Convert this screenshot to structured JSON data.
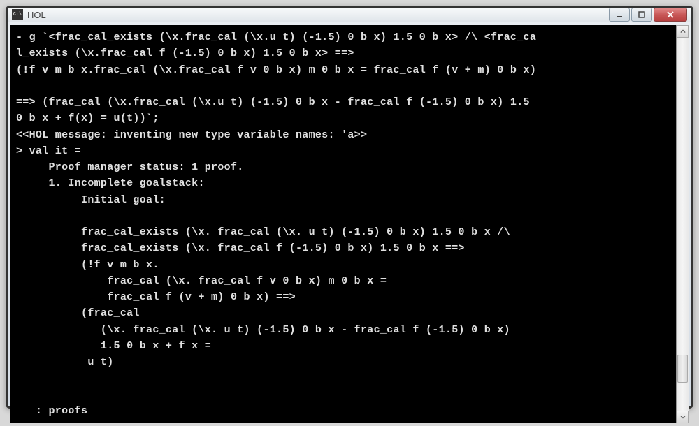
{
  "window": {
    "icon_text": "C:\\",
    "title": "HOL"
  },
  "terminal": {
    "lines": [
      "- g `<frac_cal_exists (\\x.frac_cal (\\x.u t) (-1.5) 0 b x) 1.5 0 b x> /\\ <frac_ca",
      "l_exists (\\x.frac_cal f (-1.5) 0 b x) 1.5 0 b x> ==>",
      "(!f v m b x.frac_cal (\\x.frac_cal f v 0 b x) m 0 b x = frac_cal f (v + m) 0 b x)",
      "",
      "==> (frac_cal (\\x.frac_cal (\\x.u t) (-1.5) 0 b x - frac_cal f (-1.5) 0 b x) 1.5",
      "0 b x + f(x) = u(t))`;",
      "<<HOL message: inventing new type variable names: 'a>>",
      "> val it =",
      "     Proof manager status: 1 proof.",
      "     1. Incomplete goalstack:",
      "          Initial goal:",
      "",
      "          frac_cal_exists (\\x. frac_cal (\\x. u t) (-1.5) 0 b x) 1.5 0 b x /\\",
      "          frac_cal_exists (\\x. frac_cal f (-1.5) 0 b x) 1.5 0 b x ==>",
      "          (!f v m b x.",
      "              frac_cal (\\x. frac_cal f v 0 b x) m 0 b x =",
      "              frac_cal f (v + m) 0 b x) ==>",
      "          (frac_cal",
      "             (\\x. frac_cal (\\x. u t) (-1.5) 0 b x - frac_cal f (-1.5) 0 b x)",
      "             1.5 0 b x + f x =",
      "           u t)",
      "",
      "",
      "   : proofs"
    ]
  }
}
